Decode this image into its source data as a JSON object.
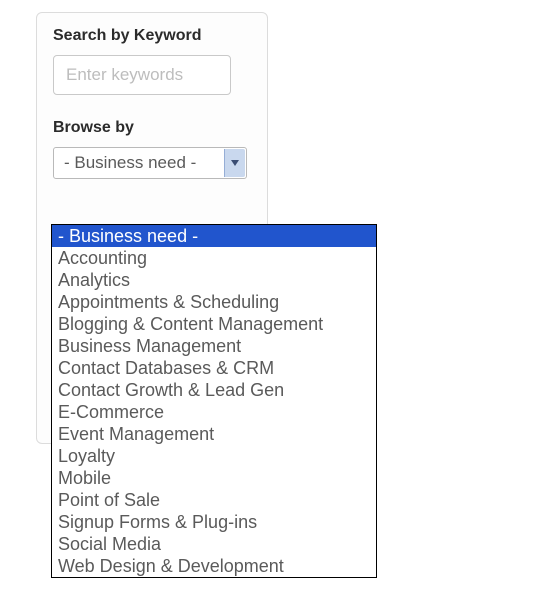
{
  "search": {
    "label": "Search by Keyword",
    "placeholder": "Enter keywords",
    "value": ""
  },
  "browse": {
    "label": "Browse by",
    "selected": "- Business need -",
    "options": [
      "- Business need -",
      "Accounting",
      "Analytics",
      "Appointments & Scheduling",
      "Blogging & Content Management",
      "Business Management",
      "Contact Databases & CRM",
      "Contact Growth & Lead Gen",
      "E-Commerce",
      "Event Management",
      "Loyalty",
      "Mobile",
      "Point of Sale",
      "Signup Forms & Plug-ins",
      "Social Media",
      "Web Design & Development"
    ],
    "highlighted_index": 0
  }
}
